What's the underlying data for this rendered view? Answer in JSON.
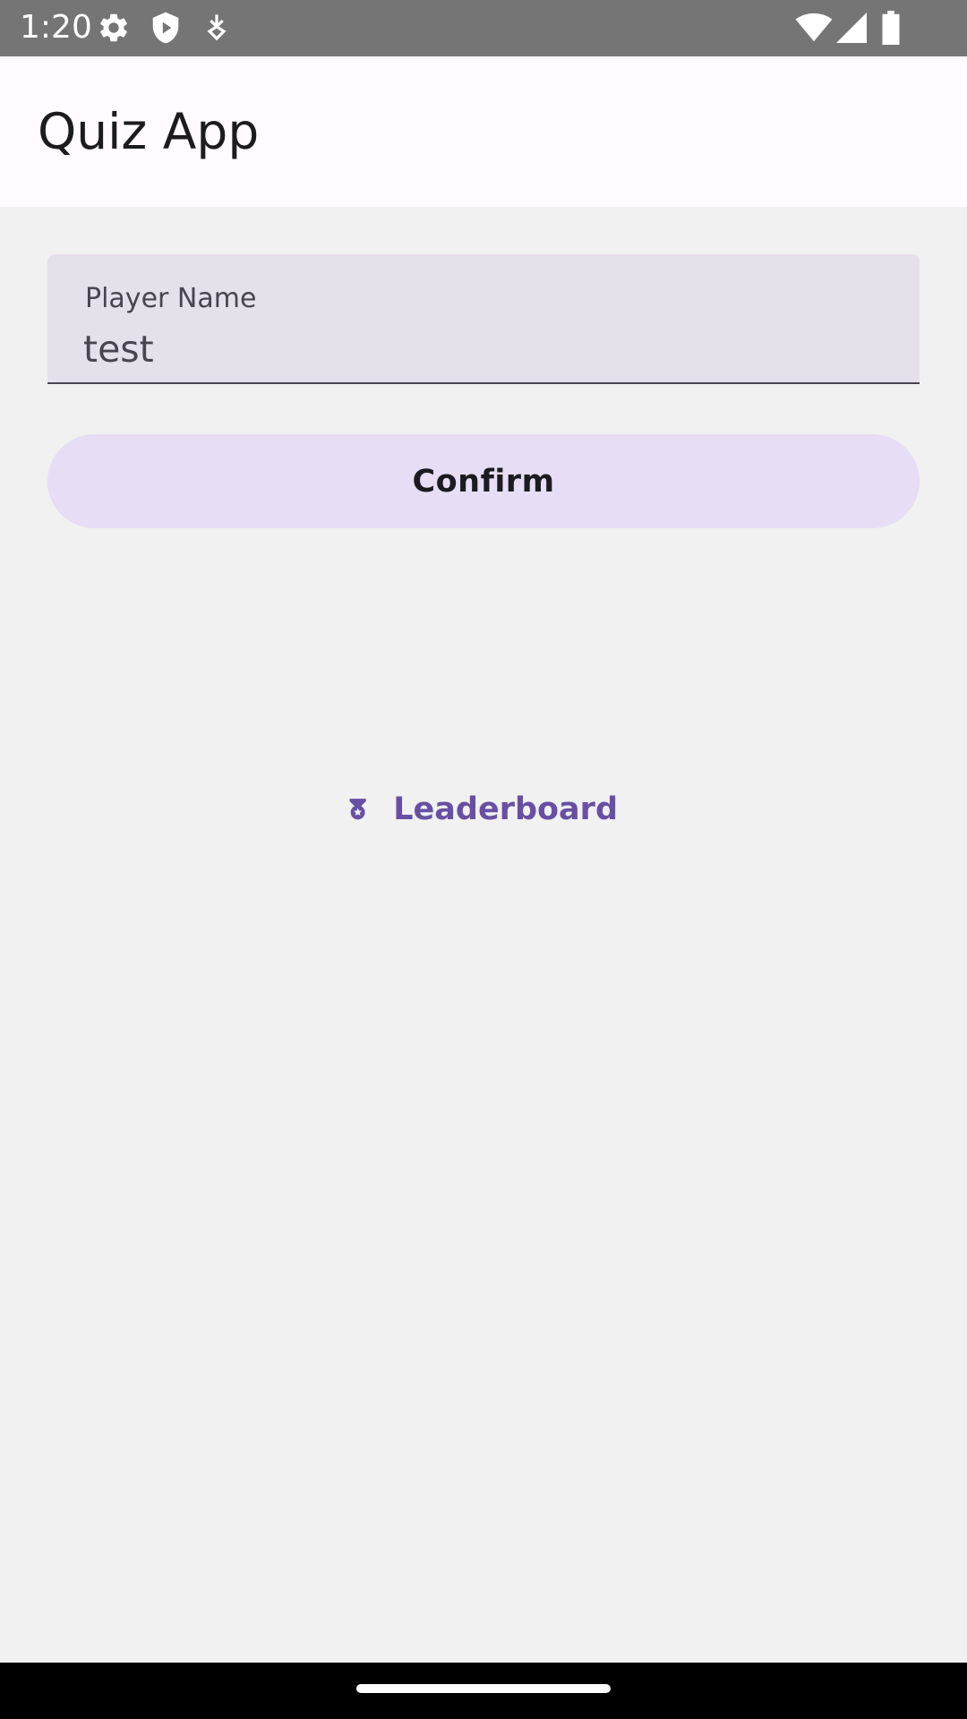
{
  "status_bar": {
    "time": "1:20",
    "left_icons": [
      "gear-icon",
      "shield-icon",
      "download-icon"
    ],
    "right_icons": [
      "wifi-icon",
      "cellular-signal-icon",
      "battery-icon"
    ]
  },
  "app_bar": {
    "title": "Quiz App"
  },
  "player_name_field": {
    "label": "Player Name",
    "value": "test"
  },
  "confirm_button": {
    "label": "Confirm"
  },
  "leaderboard_button": {
    "icon": "medal-icon",
    "label": "Leaderboard"
  },
  "colors": {
    "accent": "#6750a4",
    "button_container": "#e7def6",
    "field_container": "#e6e0eb",
    "background": "#f1f1f1",
    "status_bar": "#757575"
  }
}
